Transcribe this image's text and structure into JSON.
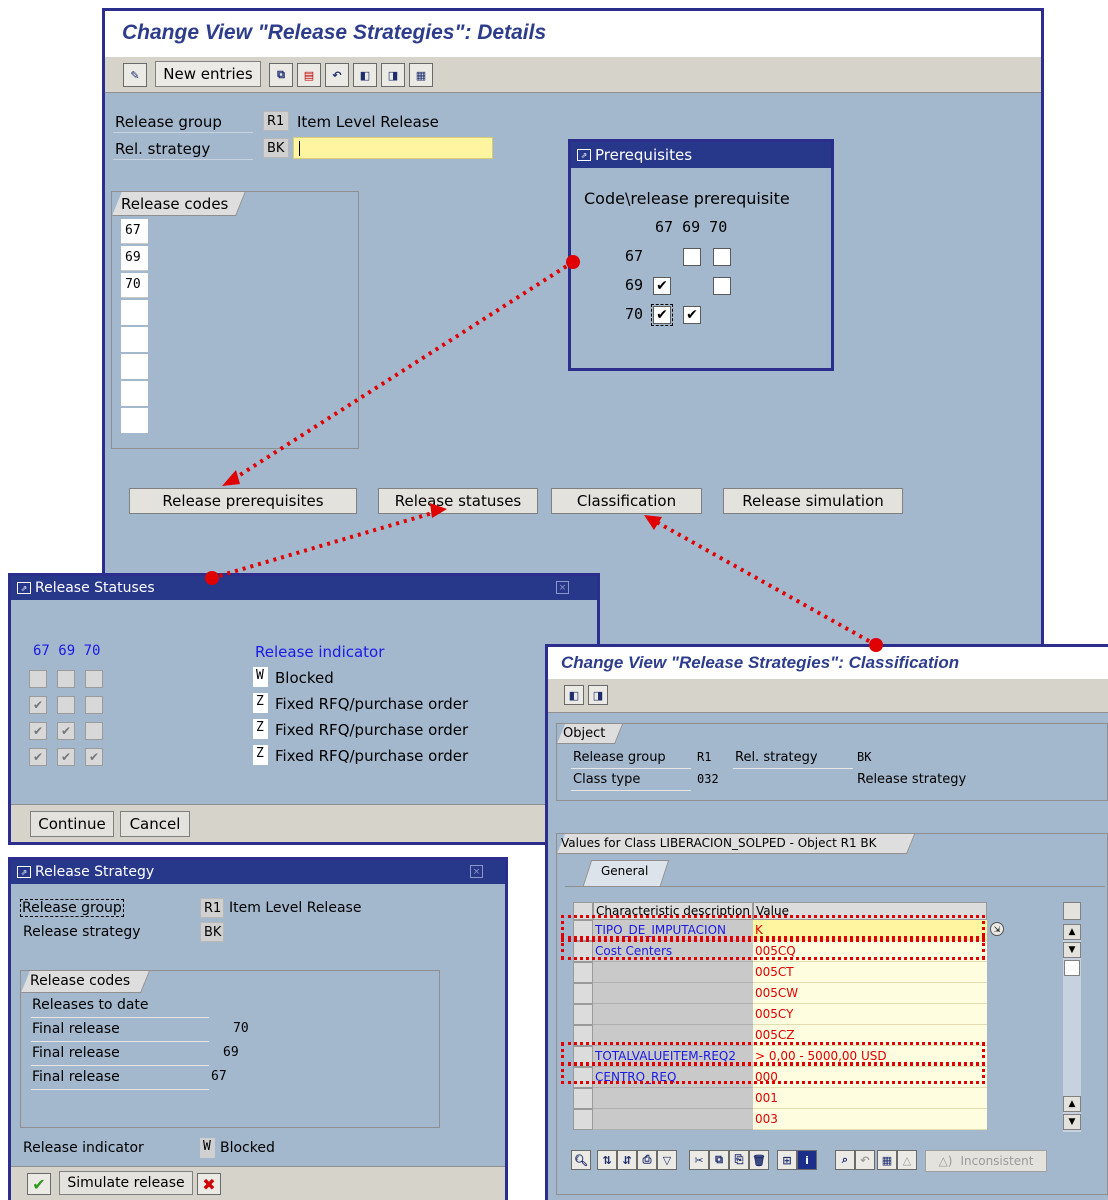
{
  "main": {
    "title": "Change View \"Release Strategies\": Details",
    "new_entries": "New entries",
    "release_group_label": "Release group",
    "release_group_value": "R1",
    "release_group_desc": "Item Level Release",
    "rel_strategy_label": "Rel. strategy",
    "rel_strategy_value": "BK",
    "release_codes_header": "Release codes",
    "release_codes": [
      "67",
      "69",
      "70"
    ],
    "buttons": {
      "prereq": "Release prerequisites",
      "statuses": "Release statuses",
      "classification": "Classification",
      "simulation": "Release simulation"
    }
  },
  "prerequisites": {
    "title": "Prerequisites",
    "subtitle": "Code\\release prerequisite",
    "col_headers": "67 69 70",
    "rows": [
      {
        "code": "67",
        "checks": [
          null,
          false,
          false
        ]
      },
      {
        "code": "69",
        "checks": [
          true,
          null,
          false
        ]
      },
      {
        "code": "70",
        "checks": [
          true,
          true,
          null
        ]
      }
    ]
  },
  "statuses": {
    "title": "Release Statuses",
    "col_headers": "67 69 70",
    "indicator_header": "Release indicator",
    "rows": [
      {
        "checks": [
          false,
          false,
          false
        ],
        "code": "W",
        "text": "Blocked"
      },
      {
        "checks": [
          true,
          false,
          false
        ],
        "code": "Z",
        "text": "Fixed RFQ/purchase order"
      },
      {
        "checks": [
          true,
          true,
          false
        ],
        "code": "Z",
        "text": "Fixed RFQ/purchase order"
      },
      {
        "checks": [
          true,
          true,
          true
        ],
        "code": "Z",
        "text": "Fixed RFQ/purchase order"
      }
    ],
    "continue": "Continue",
    "cancel": "Cancel"
  },
  "strategy": {
    "title": "Release Strategy",
    "release_group_label": "Release group",
    "release_group_value": "R1",
    "release_group_desc": "Item Level Release",
    "release_strategy_label": "Release strategy",
    "release_strategy_value": "BK",
    "release_codes_header": "Release codes",
    "releases_to_date": "Releases to date",
    "final_label": "Final release",
    "finals": [
      "70",
      "69",
      "67"
    ],
    "release_indicator_label": "Release indicator",
    "release_indicator_code": "W",
    "release_indicator_text": "Blocked",
    "simulate": "Simulate release"
  },
  "classification": {
    "title": "Change View \"Release Strategies\": Classification",
    "object_header": "Object",
    "release_group_label": "Release group",
    "release_group_value": "R1",
    "rel_strategy_label": "Rel. strategy",
    "rel_strategy_value": "BK",
    "class_type_label": "Class type",
    "class_type_value": "032",
    "class_type_desc": "Release strategy",
    "values_header": "Values for Class LIBERACION_SOLPED - Object R1 BK",
    "tab_general": "General",
    "col_desc": "Characteristic description",
    "col_value": "Value",
    "rows": [
      {
        "desc": "TIPO_DE_IMPUTACION",
        "value": "K"
      },
      {
        "desc": "Cost Centers",
        "value": "005CQ"
      },
      {
        "desc": "",
        "value": "005CT"
      },
      {
        "desc": "",
        "value": "005CW"
      },
      {
        "desc": "",
        "value": "005CY"
      },
      {
        "desc": "",
        "value": "005CZ"
      },
      {
        "desc": "TOTALVALUEITEM-REQ2",
        "value": "> 0,00 - 5000,00 USD"
      },
      {
        "desc": "CENTRO_REQ",
        "value": "000"
      },
      {
        "desc": "",
        "value": "001"
      },
      {
        "desc": "",
        "value": "003"
      }
    ],
    "inconsistent": "Inconsistent"
  },
  "colors": {
    "window_bg": "#a4b8cd",
    "frame": "#2b2e8c",
    "title_text": "#2d3d8c",
    "highlight": "#e00000",
    "link_blue": "#1a1ae6",
    "value_red": "#e00000",
    "input_yellow": "#fff5a0"
  }
}
